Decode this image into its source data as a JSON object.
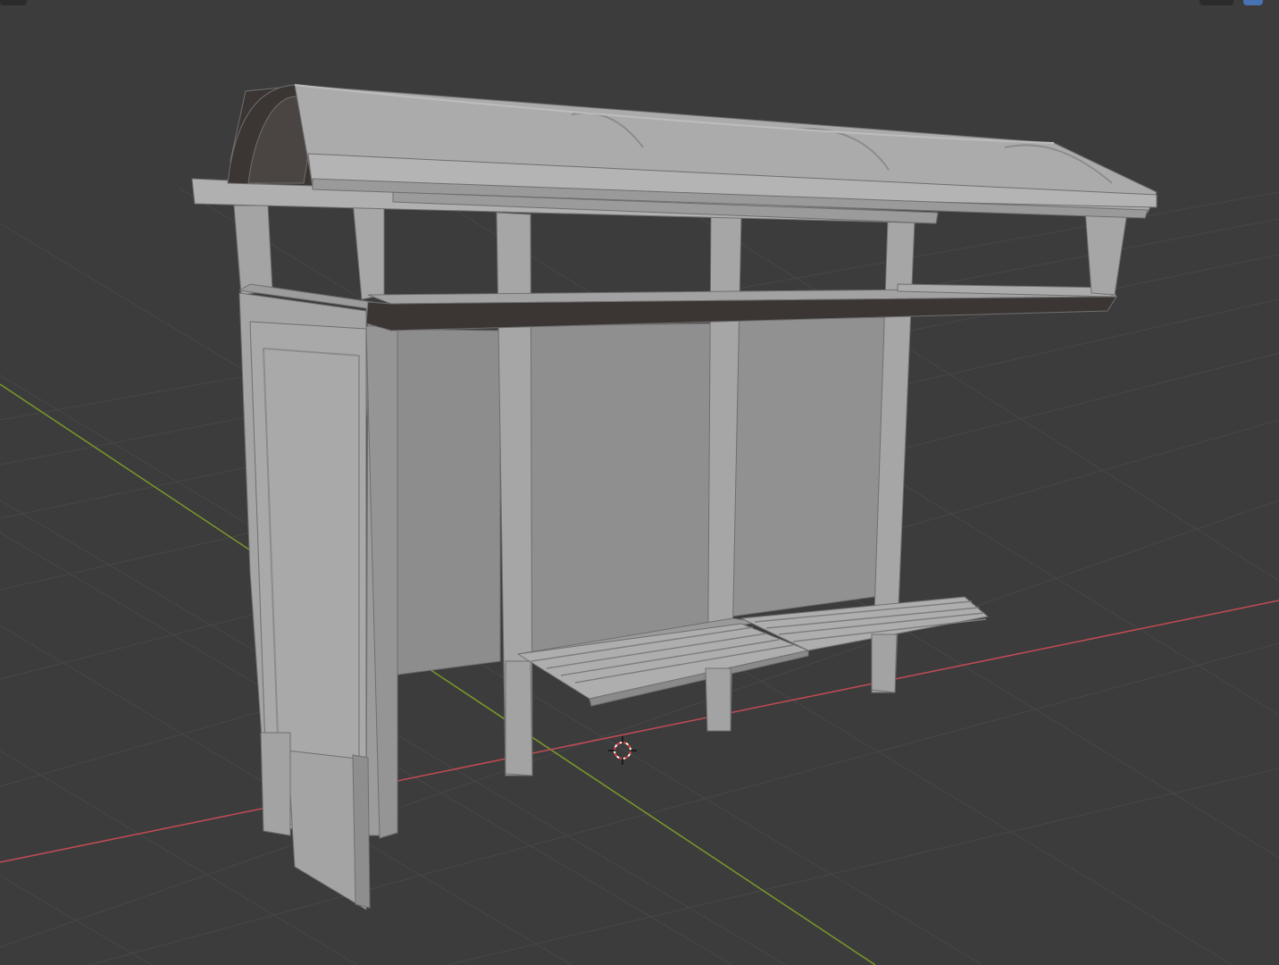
{
  "app": "Blender",
  "viewport": {
    "mode": "3d-viewport",
    "shading": "solid",
    "object": "bus-shelter",
    "colors": {
      "background": "#3c3c3c",
      "grid_line": "#474747",
      "x_axis": "#c24b54",
      "y_axis": "#7a9a2a",
      "model_light": "#a3a3a3",
      "model_mid": "#8f8f8f",
      "model_dark": "#3b3533",
      "cursor": "#e04040"
    }
  },
  "overlays": {
    "header_buttons": [
      "viewport-shading-button",
      "viewport-overlay-toggle"
    ],
    "icons": [
      "3d-cursor-icon"
    ]
  }
}
